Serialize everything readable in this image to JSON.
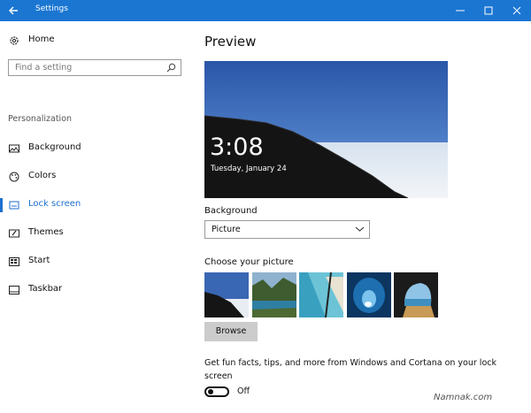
{
  "window": {
    "title": "Settings"
  },
  "sidebar": {
    "home_label": "Home",
    "search_placeholder": "Find a setting",
    "section_title": "Personalization",
    "items": [
      {
        "label": "Background",
        "icon": "picture-icon"
      },
      {
        "label": "Colors",
        "icon": "palette-icon"
      },
      {
        "label": "Lock screen",
        "icon": "lock-screen-icon",
        "selected": true
      },
      {
        "label": "Themes",
        "icon": "themes-icon"
      },
      {
        "label": "Start",
        "icon": "start-icon"
      },
      {
        "label": "Taskbar",
        "icon": "taskbar-icon"
      }
    ]
  },
  "main": {
    "preview_title": "Preview",
    "preview_time": "3:08",
    "preview_date": "Tuesday, January 24",
    "background_label": "Background",
    "background_value": "Picture",
    "choose_label": "Choose your picture",
    "browse_label": "Browse",
    "tips_text": "Get fun facts, tips, and more from Windows and Cortana on your lock screen",
    "toggle_state": "Off"
  },
  "watermark": "Namnak.com",
  "colors": {
    "accent": "#1e6fcf",
    "titlebar": "#1b76d2"
  }
}
